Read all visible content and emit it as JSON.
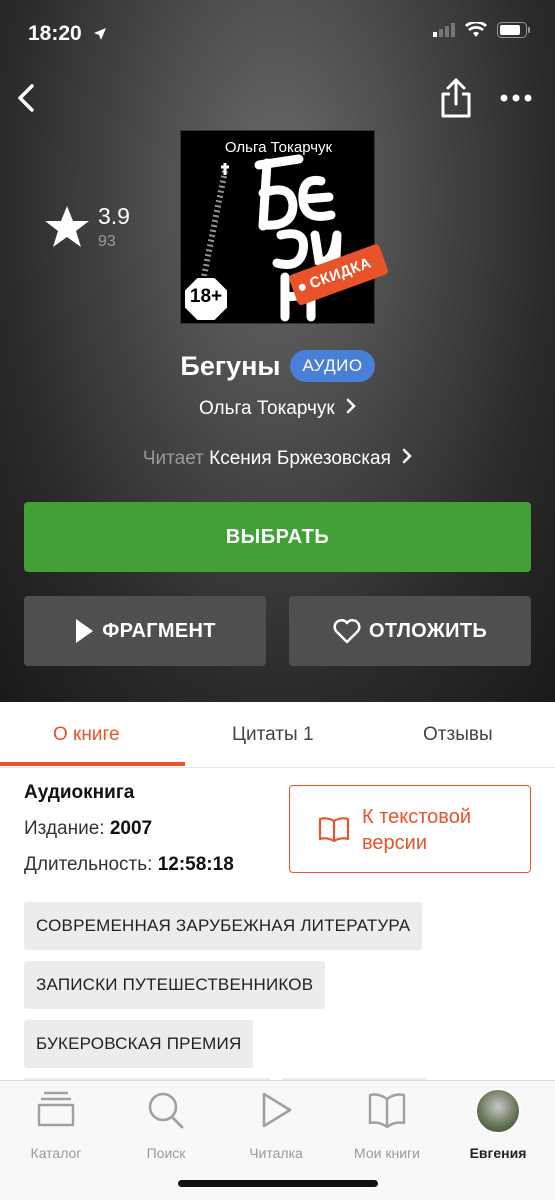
{
  "status_bar": {
    "time": "18:20"
  },
  "book": {
    "cover_author": "Ольга Токарчук",
    "age_rating": "18+",
    "sale_label": "СКИДКА",
    "title": "Бегуны",
    "format_badge": "АУДИО",
    "author": "Ольга Токарчук",
    "reader_label": "Читает",
    "reader_name": "Ксения Бржезовская"
  },
  "rating": {
    "value": "3.9",
    "count": "93"
  },
  "actions": {
    "select": "ВЫБРАТЬ",
    "fragment": "ФРАГМЕНТ",
    "later": "ОТЛОЖИТЬ"
  },
  "tabs": [
    {
      "label": "О книге",
      "active": true
    },
    {
      "label": "Цитаты 1",
      "active": false
    },
    {
      "label": "Отзывы",
      "active": false
    }
  ],
  "info": {
    "type": "Аудиокнига",
    "edition_label": "Издание:",
    "edition_value": "2007",
    "duration_label": "Длительность:",
    "duration_value": "12:58:18",
    "text_version_label": "К текстовой версии"
  },
  "tags": [
    "СОВРЕМЕННАЯ ЗАРУБЕЖНАЯ ЛИТЕРАТУРА",
    "ЗАПИСКИ ПУТЕШЕСТВЕННИКОВ",
    "БУКЕРОВСКАЯ ПРЕМИЯ"
  ],
  "tabbar": [
    {
      "label": "Каталог",
      "icon": "catalog-icon"
    },
    {
      "label": "Поиск",
      "icon": "search-icon"
    },
    {
      "label": "Читалка",
      "icon": "play-icon"
    },
    {
      "label": "Мои книги",
      "icon": "book-icon"
    },
    {
      "label": "Евгения",
      "icon": "avatar",
      "active": true
    }
  ],
  "colors": {
    "accent": "#e8532a",
    "green": "#43a037",
    "audio_badge": "#4a7fd8"
  }
}
